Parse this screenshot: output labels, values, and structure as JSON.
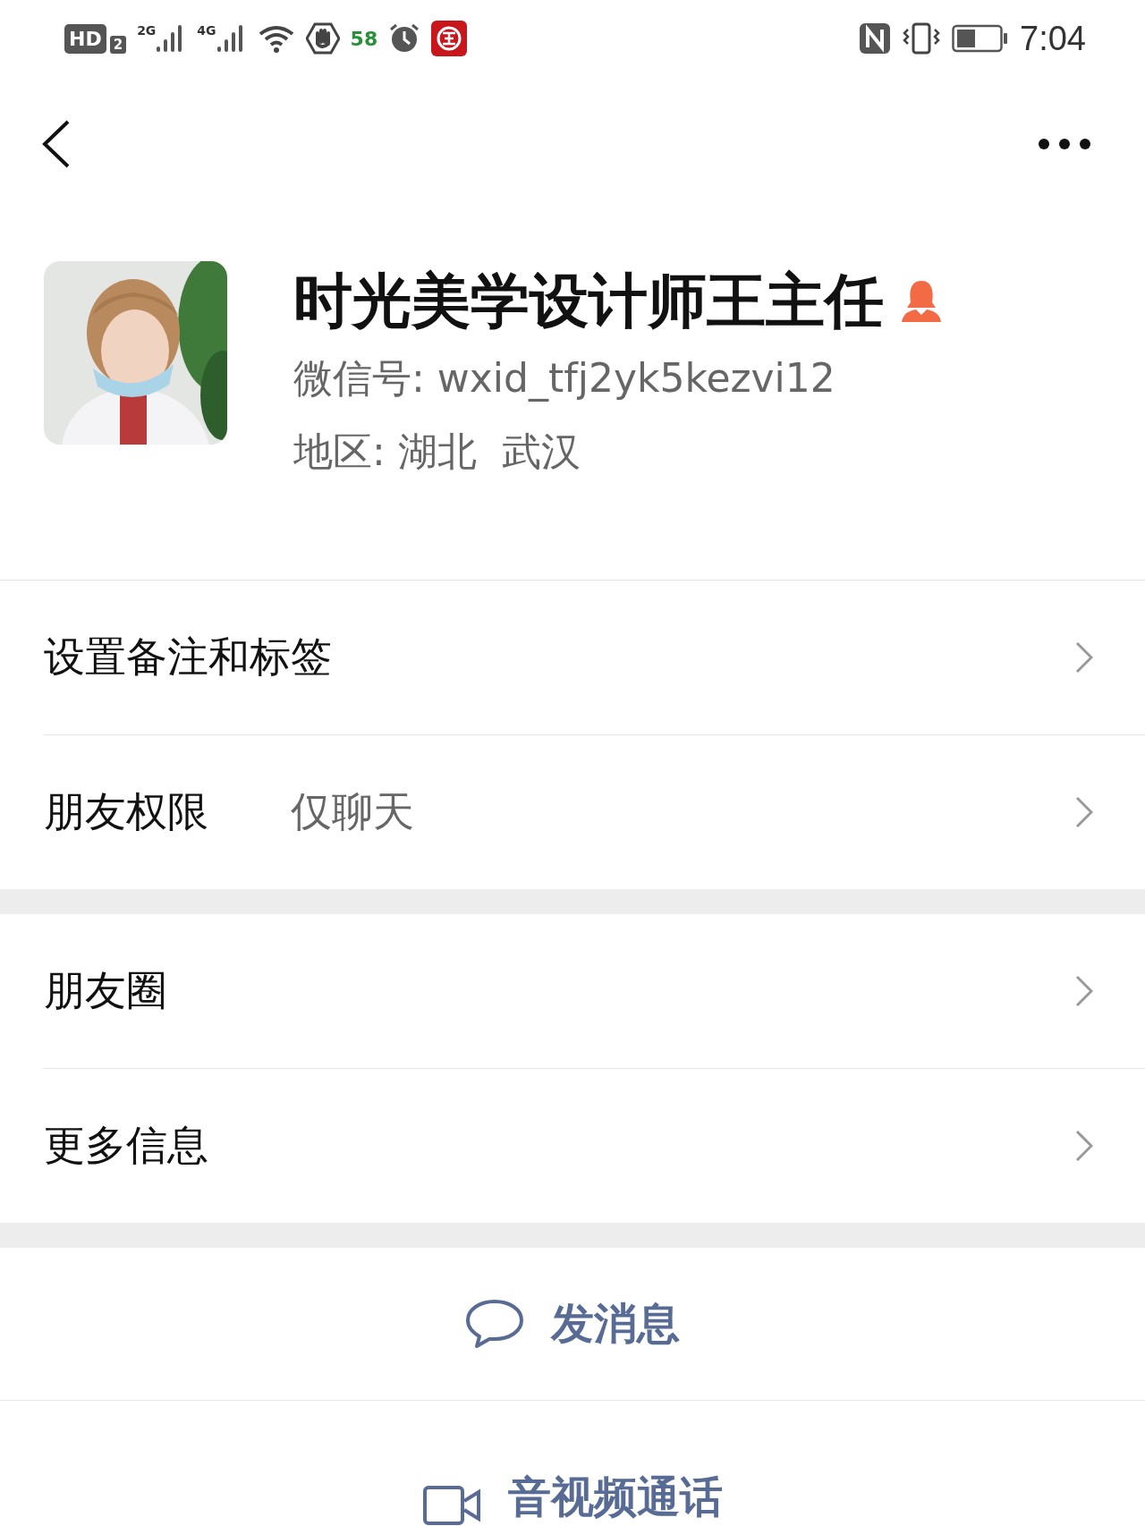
{
  "status_bar": {
    "hd_label": "HD",
    "sim_label": "2",
    "signals": [
      {
        "label": "2G"
      },
      {
        "label": "4G"
      }
    ],
    "app_badge": "58",
    "time": "7:04"
  },
  "profile": {
    "name": "时光美学设计师王主任",
    "fields": [
      {
        "label": "微信号:",
        "value": "wxid_tfj2yk5kezvi12"
      },
      {
        "label": "地区:",
        "value": "湖北  武汉"
      }
    ]
  },
  "sections": [
    {
      "rows": [
        {
          "label": "设置备注和标签"
        },
        {
          "label": "朋友权限",
          "value": "仅聊天"
        }
      ]
    },
    {
      "rows": [
        {
          "label": "朋友圈"
        },
        {
          "label": "更多信息"
        }
      ]
    }
  ],
  "actions": [
    {
      "kind": "message",
      "label": "发消息"
    },
    {
      "kind": "video",
      "label": "音视频通话"
    }
  ]
}
